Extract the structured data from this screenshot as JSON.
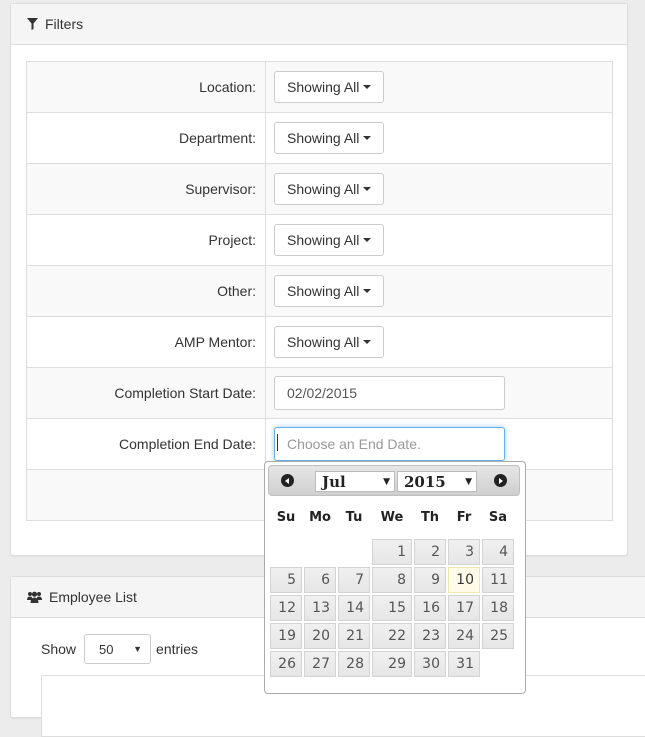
{
  "filters_panel": {
    "title": "Filters",
    "icon": "filter-icon",
    "rows": [
      {
        "label": "Location:",
        "type": "dropdown",
        "value": "Showing All"
      },
      {
        "label": "Department:",
        "type": "dropdown",
        "value": "Showing All"
      },
      {
        "label": "Supervisor:",
        "type": "dropdown",
        "value": "Showing All"
      },
      {
        "label": "Project:",
        "type": "dropdown",
        "value": "Showing All"
      },
      {
        "label": "Other:",
        "type": "dropdown",
        "value": "Showing All"
      },
      {
        "label": "AMP Mentor:",
        "type": "dropdown",
        "value": "Showing All"
      },
      {
        "label": "Completion Start Date:",
        "type": "text",
        "value": "02/02/2015",
        "placeholder": ""
      },
      {
        "label": "Completion End Date:",
        "type": "text",
        "value": "",
        "placeholder": "Choose an End Date."
      }
    ]
  },
  "datepicker": {
    "prev_icon": "circle-triangle-left-icon",
    "next_icon": "circle-triangle-right-icon",
    "month": "Jul",
    "year": "2015",
    "weekdays": [
      "Su",
      "Mo",
      "Tu",
      "We",
      "Th",
      "Fr",
      "Sa"
    ],
    "weeks": [
      [
        "",
        "",
        "",
        "1",
        "2",
        "3",
        "4"
      ],
      [
        "5",
        "6",
        "7",
        "8",
        "9",
        "10",
        "11"
      ],
      [
        "12",
        "13",
        "14",
        "15",
        "16",
        "17",
        "18"
      ],
      [
        "19",
        "20",
        "21",
        "22",
        "23",
        "24",
        "25"
      ],
      [
        "26",
        "27",
        "28",
        "29",
        "30",
        "31",
        ""
      ]
    ],
    "today": "10",
    "colors": {
      "today_bg": "#fffbe8",
      "day_bg": "#e6e6e6"
    }
  },
  "employee_panel": {
    "title": "Employee List",
    "icon": "users-icon",
    "show_label": "Show",
    "entries_value": "50",
    "entries_label": "entries"
  }
}
